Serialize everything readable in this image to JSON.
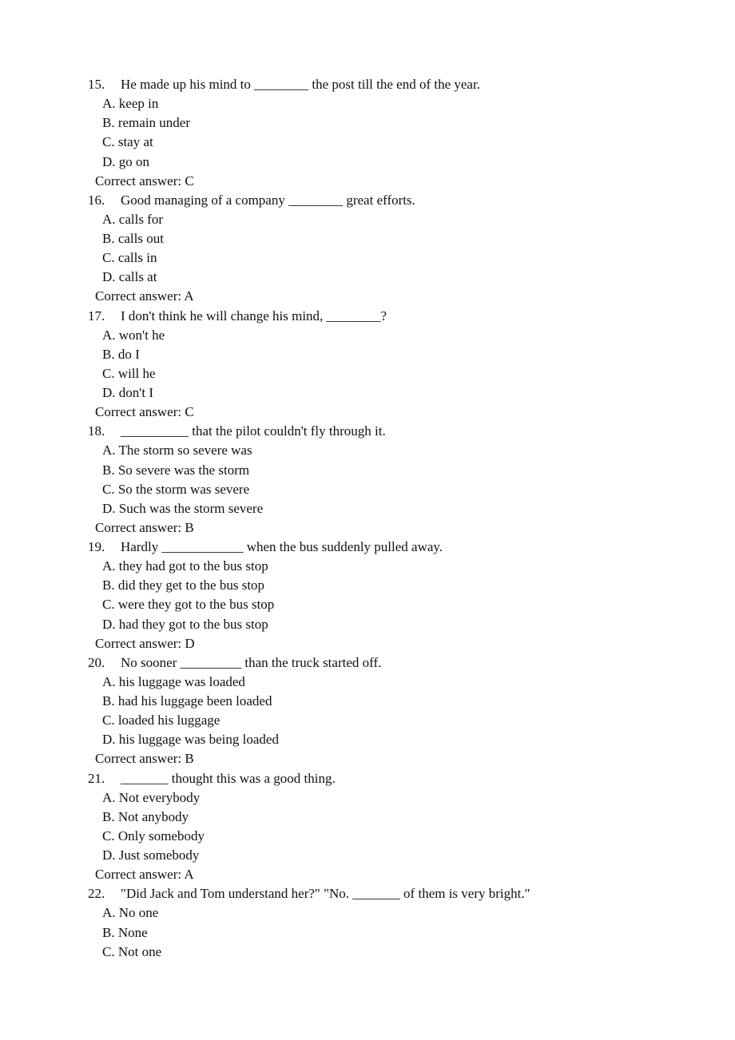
{
  "answer_prefix": "Correct answer: ",
  "questions": [
    {
      "number": "15.",
      "stem": "He made up his mind to ________ the post till the end of the year.",
      "options": [
        "A. keep in",
        "B. remain under",
        "C. stay at",
        "D. go on"
      ],
      "answer": "C"
    },
    {
      "number": "16.",
      "stem": "Good managing of a company ________ great efforts.",
      "options": [
        "A. calls for",
        "B. calls out",
        "C. calls in",
        "D. calls at"
      ],
      "answer": "A"
    },
    {
      "number": "17.",
      "stem": "I don't think he will change his mind, ________?",
      "options": [
        "A. won't he",
        "B. do I",
        "C. will he",
        "D. don't I"
      ],
      "answer": "C"
    },
    {
      "number": "18.",
      "stem": "__________ that the pilot couldn't fly through it.",
      "options": [
        "A. The storm so severe was",
        "B. So severe was the storm",
        "C. So the storm was severe",
        "D. Such was the storm severe"
      ],
      "answer": "B"
    },
    {
      "number": "19.",
      "stem": "Hardly ____________ when the bus suddenly pulled away.",
      "options": [
        "A. they had got to the bus stop",
        "B. did they get to the bus stop",
        "C. were they got to the bus stop",
        "D. had they got to the bus stop"
      ],
      "answer": "D"
    },
    {
      "number": "20.",
      "stem": "No sooner _________ than the truck started off.",
      "options": [
        "A. his luggage was loaded",
        "B. had his luggage been loaded",
        "C. loaded his luggage",
        "D. his luggage was being loaded"
      ],
      "answer": "B"
    },
    {
      "number": "21.",
      "stem": "_______ thought this was a good thing.",
      "options": [
        "A. Not everybody",
        "B. Not anybody",
        "C. Only somebody",
        "D. Just somebody"
      ],
      "answer": "A"
    },
    {
      "number": "22.",
      "stem": "\"Did Jack and Tom understand her?\" \"No. _______ of them is very bright.\"",
      "options": [
        "A. No one",
        "B. None",
        "C. Not one"
      ],
      "answer": null
    }
  ]
}
